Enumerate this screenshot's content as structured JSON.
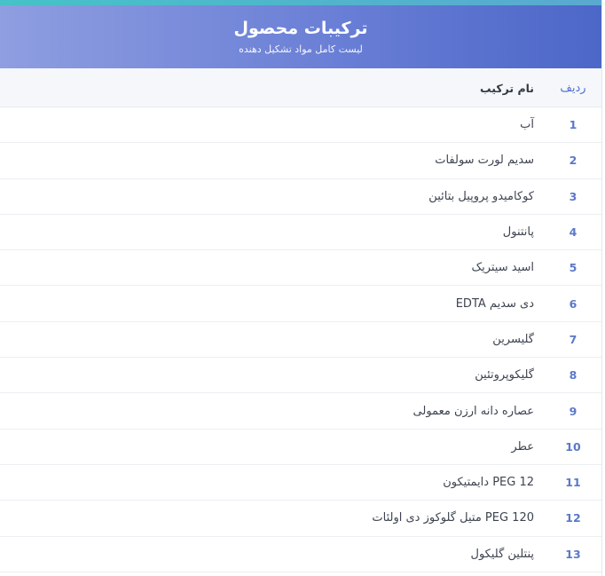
{
  "header": {
    "title": "ترکیبات محصول",
    "subtitle": "لیست کامل مواد تشکیل دهنده"
  },
  "table": {
    "columns": {
      "index": "ردیف",
      "name": "نام ترکیب"
    },
    "rows": [
      {
        "index": "1",
        "name": "آب"
      },
      {
        "index": "2",
        "name": "سدیم لورت سولفات"
      },
      {
        "index": "3",
        "name": "کوکامیدو پروپیل بتائین"
      },
      {
        "index": "4",
        "name": "پانتنول"
      },
      {
        "index": "5",
        "name": "اسید سیتریک"
      },
      {
        "index": "6",
        "name": "دی سدیم EDTA"
      },
      {
        "index": "7",
        "name": "گلیسرین"
      },
      {
        "index": "8",
        "name": "گلیکوپروتئین"
      },
      {
        "index": "9",
        "name": "عصاره دانه ارزن معمولی"
      },
      {
        "index": "10",
        "name": "عطر"
      },
      {
        "index": "11",
        "name": "PEG 12 دایمتیکون"
      },
      {
        "index": "12",
        "name": "PEG 120 متیل گلوکوز دی اولئات"
      },
      {
        "index": "13",
        "name": "پنتلین گلیکول"
      }
    ]
  },
  "colors": {
    "header_start": "#8f9ee0",
    "header_end": "#4c67c8",
    "accent_strip": "#46c2c8",
    "index_text": "#5b78c9"
  }
}
